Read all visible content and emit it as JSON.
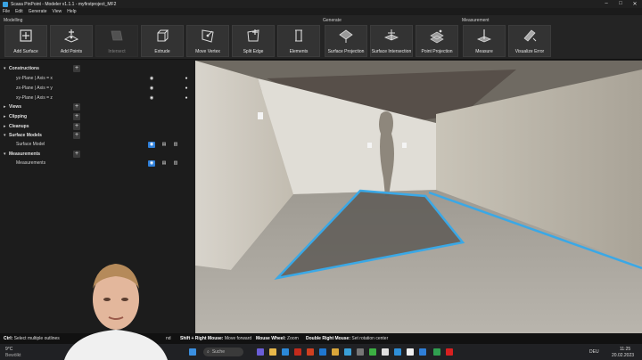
{
  "window": {
    "title": "Scasa PinPoint - Modeler v1.1.1 - myfirstproject_MF2"
  },
  "menu": [
    "File",
    "Edit",
    "Generate",
    "View",
    "Help"
  ],
  "ribbon": {
    "groups": {
      "modelling": "Modelling",
      "generate": "Generate",
      "measurement": "Measurement"
    },
    "tools": [
      {
        "label": "Add Surface",
        "icon": "add-surface-icon"
      },
      {
        "label": "Add Points",
        "icon": "add-points-icon"
      },
      {
        "label": "Intersect",
        "icon": "intersect-icon"
      },
      {
        "label": "Extrude",
        "icon": "extrude-icon"
      },
      {
        "label": "Move Vertex",
        "icon": "move-vertex-icon"
      },
      {
        "label": "Split Edge",
        "icon": "split-edge-icon"
      },
      {
        "label": "Elements",
        "icon": "elements-icon"
      },
      {
        "label": "Surface Projection",
        "icon": "surface-projection-icon"
      },
      {
        "label": "Surface Intersection",
        "icon": "surface-intersection-icon"
      },
      {
        "label": "Point Projection",
        "icon": "point-projection-icon"
      },
      {
        "label": "Measure",
        "icon": "measure-icon"
      },
      {
        "label": "Visualize Error",
        "icon": "visualize-error-icon"
      }
    ]
  },
  "tree": {
    "constructions": "Constructions",
    "planes": [
      "yz-Plane | Axis = x",
      "zx-Plane | Axis = y",
      "xy-Plane | Axis = z"
    ],
    "views": "Views",
    "clipping": "Clipping",
    "cleanups": "Cleanups",
    "surface_models": "Surface Models",
    "surface_model": "Surface Model",
    "measurements": "Measurements",
    "measurements_child": "Measurements"
  },
  "status": {
    "ctrl_key": "Ctrl:",
    "ctrl_text": "Select multiple outlines",
    "shift_key": "Shift + Right Mouse:",
    "shift_text": "Move forward",
    "wheel_key": "Mouse Wheel:",
    "wheel_text": "Zoom",
    "dbl_key": "Double Right Mouse:",
    "dbl_text": "Set rotation center",
    "partial_text": "nd"
  },
  "taskbar": {
    "weather_temp": "9°C",
    "weather_text": "Bewölkt",
    "search_label": "Suche",
    "lang": "DEU",
    "time": "11:25",
    "date": "20.02.2023"
  },
  "colors": {
    "accent": "#2f7fd8",
    "outline": "#3aa8e6"
  }
}
